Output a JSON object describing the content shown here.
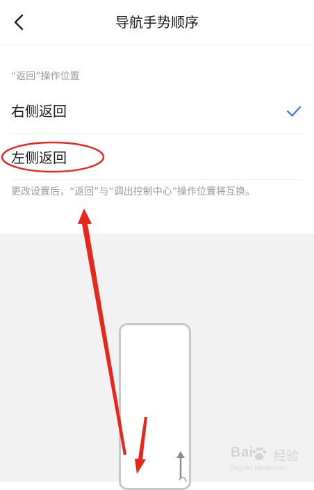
{
  "header": {
    "title": "导航手势顺序"
  },
  "section": {
    "label": "“返回”操作位置"
  },
  "options": [
    {
      "label": "右侧返回",
      "selected": true
    },
    {
      "label": "左侧返回",
      "selected": false
    }
  ],
  "note": "更改设置后，“返回”与“调出控制中心”操作位置将互换。",
  "colors": {
    "accent": "#3b72f2",
    "annotation": "#e8261c",
    "preview_bg": "#f2f2f2"
  },
  "watermark": {
    "brand": "Bai",
    "brand_cn": "经验",
    "sub": "jingyan.baidu.com"
  }
}
